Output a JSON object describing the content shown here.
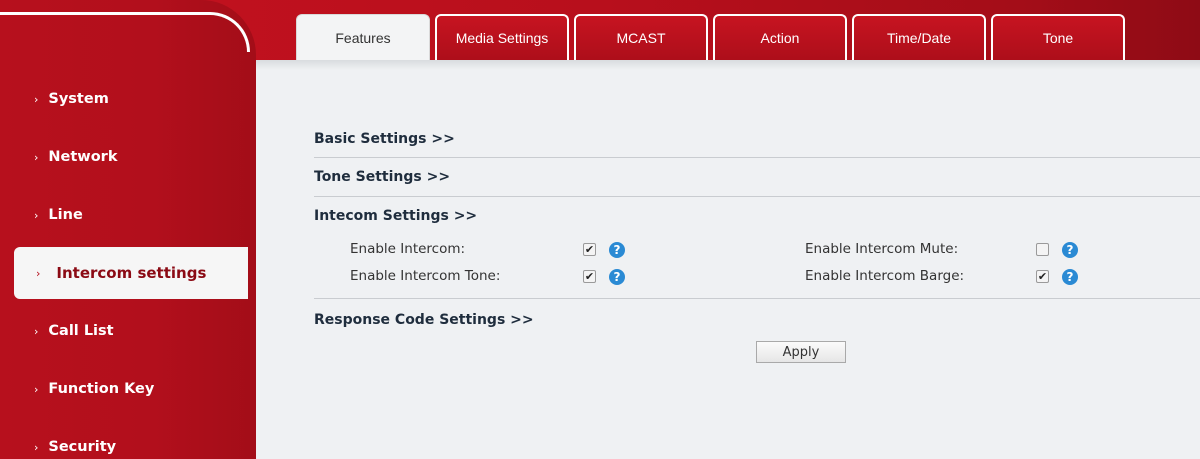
{
  "sidebar": {
    "items": [
      {
        "label": "System"
      },
      {
        "label": "Network"
      },
      {
        "label": "Line"
      },
      {
        "label": "Intercom settings"
      },
      {
        "label": "Call List"
      },
      {
        "label": "Function Key"
      },
      {
        "label": "Security"
      }
    ],
    "chevron": "›"
  },
  "tabs": [
    {
      "label": "Features"
    },
    {
      "label": "Media Settings"
    },
    {
      "label": "MCAST"
    },
    {
      "label": "Action"
    },
    {
      "label": "Time/Date"
    },
    {
      "label": "Tone"
    }
  ],
  "sections": {
    "basic": "Basic Settings >>",
    "tone": "Tone Settings >>",
    "intercom": "Intecom Settings >>",
    "response": "Response Code Settings >>"
  },
  "intercom_fields": {
    "enable_intercom": {
      "label": "Enable Intercom:",
      "checked": true
    },
    "enable_intercom_tone": {
      "label": "Enable Intercom Tone:",
      "checked": true
    },
    "enable_intercom_mute": {
      "label": "Enable Intercom Mute:",
      "checked": false
    },
    "enable_intercom_barge": {
      "label": "Enable Intercom Barge:",
      "checked": true
    }
  },
  "help_glyph": "?",
  "check_glyph": "✔",
  "apply_label": "Apply",
  "colors": {
    "brand_red": "#b50f1c",
    "help_blue": "#2a8ad4",
    "content_bg": "#eff1f3"
  }
}
